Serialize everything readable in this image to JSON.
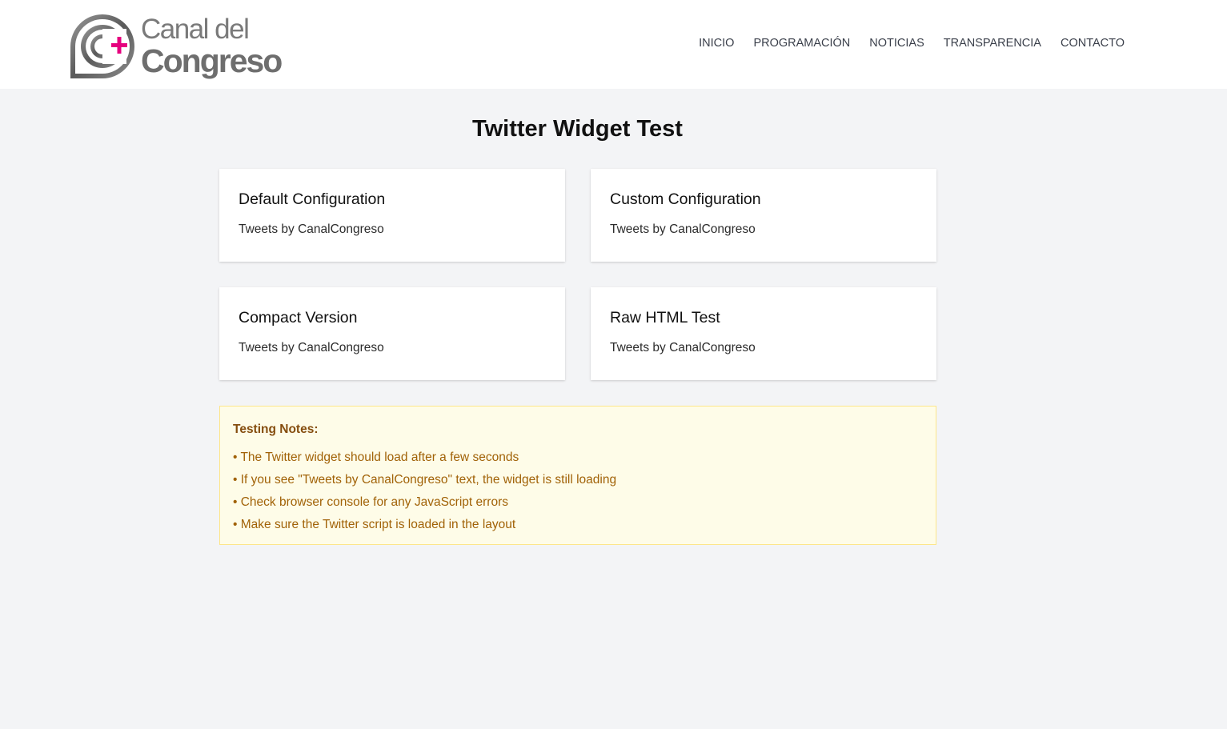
{
  "header": {
    "logo": {
      "line1": "Canal del",
      "line2": "Congreso",
      "accent_color": "#e6007e"
    },
    "nav": [
      {
        "label": "INICIO"
      },
      {
        "label": "PROGRAMACIÓN"
      },
      {
        "label": "NOTICIAS"
      },
      {
        "label": "TRANSPARENCIA"
      },
      {
        "label": "CONTACTO"
      }
    ]
  },
  "main": {
    "title": "Twitter Widget Test",
    "cards": [
      {
        "title": "Default Configuration",
        "link": "Tweets by CanalCongreso"
      },
      {
        "title": "Custom Configuration",
        "link": "Tweets by CanalCongreso"
      },
      {
        "title": "Compact Version",
        "link": "Tweets by CanalCongreso"
      },
      {
        "title": "Raw HTML Test",
        "link": "Tweets by CanalCongreso"
      }
    ],
    "notes": {
      "title": "Testing Notes:",
      "items": [
        "• The Twitter widget should load after a few seconds",
        "• If you see \"Tweets by CanalCongreso\" text, the widget is still loading",
        "• Check browser console for any JavaScript errors",
        "• Make sure the Twitter script is loaded in the layout"
      ]
    }
  },
  "colors": {
    "background": "#f3f4f6",
    "card": "#ffffff",
    "notes_background": "#fefce8",
    "notes_border": "#fde68a",
    "notes_text": "#a16207"
  }
}
